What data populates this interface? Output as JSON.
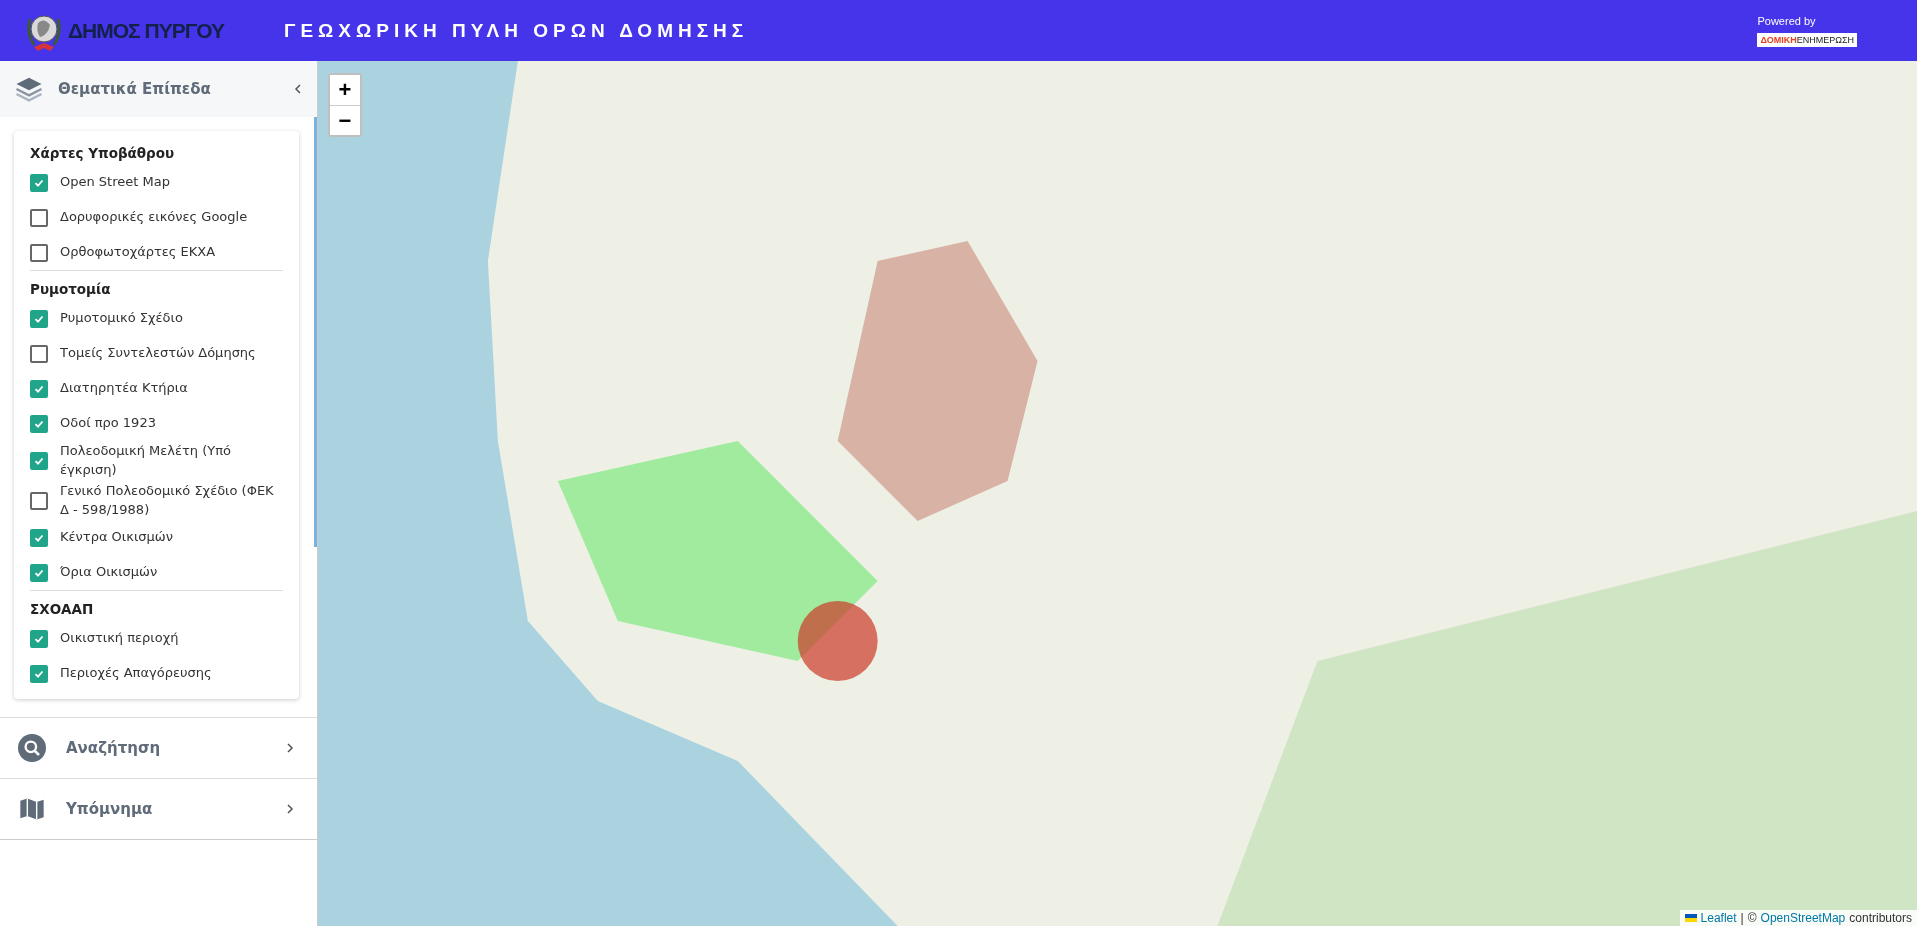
{
  "header": {
    "logo_text": "ΔΗΜΟΣ ΠΥΡΓΟΥ",
    "title": "ΓΕΩΧΩΡΙΚΗ ΠΥΛΗ ΟΡΩΝ ΔΟΜΗΣΗΣ",
    "powered_by": "Powered by",
    "brand_parts": [
      "ΔΟΜΙΚΗ",
      "ΕΝΗΜΕΡΩΣΗ"
    ]
  },
  "sidebar": {
    "layers_panel": {
      "title": "Θεματικά Επίπεδα",
      "expanded": true,
      "sections": [
        {
          "title": "Χάρτες Υποβάθρου",
          "items": [
            {
              "label": "Open Street Map",
              "checked": true
            },
            {
              "label": "Δορυφορικές εικόνες Google",
              "checked": false
            },
            {
              "label": "Ορθοφωτοχάρτες ΕΚΧΑ",
              "checked": false
            }
          ]
        },
        {
          "title": "Ρυμοτομία",
          "items": [
            {
              "label": "Ρυμοτομικό Σχέδιο",
              "checked": true
            },
            {
              "label": "Τομείς Συντελεστών Δόμησης",
              "checked": false
            },
            {
              "label": "Διατηρητέα Κτήρια",
              "checked": true
            },
            {
              "label": "Οδοί προ 1923",
              "checked": true
            },
            {
              "label": "Πολεοδομική Μελέτη (Υπό έγκριση)",
              "checked": true
            },
            {
              "label": "Γενικό Πολεοδομικό Σχέδιο (ΦΕΚ Δ - 598/1988)",
              "checked": false
            },
            {
              "label": "Κέντρα Οικισμών",
              "checked": true
            },
            {
              "label": "Όρια Οικισμών",
              "checked": true
            }
          ]
        },
        {
          "title": "ΣΧΟΑΑΠ",
          "items": [
            {
              "label": "Οικιστική περιοχή",
              "checked": true
            },
            {
              "label": "Περιοχές Απαγόρευσης",
              "checked": true
            }
          ]
        }
      ]
    },
    "panels": [
      {
        "kind": "search",
        "title": "Αναζήτηση"
      },
      {
        "kind": "legend",
        "title": "Υπόμνημα"
      }
    ]
  },
  "map": {
    "zoom_in": "+",
    "zoom_out": "−",
    "attribution": {
      "leaflet": "Leaflet",
      "separator": "|",
      "copyright": "©",
      "osm": "OpenStreetMap",
      "suffix": "contributors"
    }
  }
}
